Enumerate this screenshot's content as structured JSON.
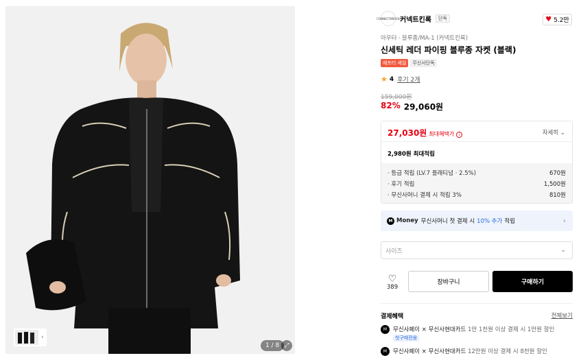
{
  "gallery": {
    "counter": "1 / 8",
    "zoom_icon": "expand-icon",
    "thumb_arrow": "›"
  },
  "brand": {
    "logo_text": "CONNECTKNOCK",
    "name": "커넥트킨록",
    "tag": "단독",
    "likes": "5.2만"
  },
  "breadcrumb": [
    "아우터",
    "블루종/MA-1 (커넥트킨록)"
  ],
  "product": {
    "title": "신세틱 레더 파이핑 블루종 자켓 (블랙)",
    "badges": [
      "애프터 세일",
      "무신사단독"
    ],
    "rating": "4",
    "review_link": "후기 2개",
    "original_price": "159,000원",
    "discount_pct": "82%",
    "price": "29,060원"
  },
  "benefits": {
    "max_amount": "27,030원",
    "max_label": "최대혜택가",
    "detail_label": "자세히",
    "points": "2,980원 최대적립",
    "lines": [
      {
        "label": "· 등급 적립 (LV.7 플래티넘 · 2.5%)",
        "value": "670원"
      },
      {
        "label": "· 후기 적립",
        "value": "1,500원"
      },
      {
        "label": "· 무신사머니 결제 시 적립 3%",
        "value": "810원"
      }
    ]
  },
  "money_banner": {
    "logo": "M",
    "label": "Money",
    "text_before": "무신사머니 첫 결제 시",
    "highlight": "10% 추가",
    "text_after": "적립"
  },
  "size_select": {
    "placeholder": "사이즈"
  },
  "actions": {
    "like_count": "389",
    "cart": "장바구니",
    "buy": "구매하기"
  },
  "payment": {
    "heading": "결제혜택",
    "view_all": "전체보기",
    "items": [
      {
        "title": "무신사페이 × 무신사현대카드",
        "detail": "1만 1천원 이상 결제 시 1만원 할인",
        "tag": "첫구매전용"
      },
      {
        "title": "무신사페이 × 무신사현대카드",
        "detail": "12만원 이상 결제 시 8천원 할인",
        "tag": ""
      }
    ]
  },
  "colors": {
    "accent_red": "#e60013",
    "sale_badge": "#f05a3e",
    "money_blue": "#2d6bdd"
  }
}
